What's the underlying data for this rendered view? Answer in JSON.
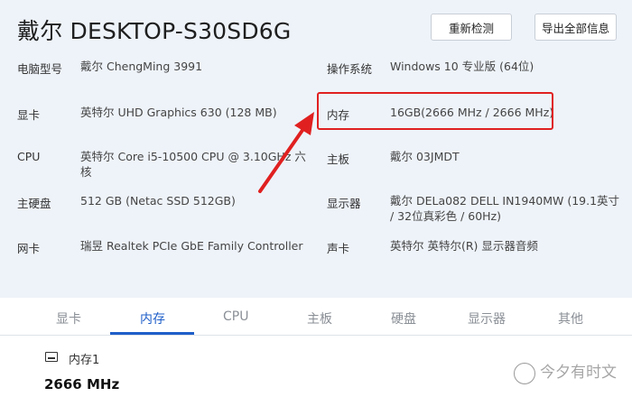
{
  "header": {
    "title": "戴尔 DESKTOP-S30SD6G",
    "redetect_label": "重新检测",
    "export_label": "导出全部信息"
  },
  "specs": {
    "model_label": "电脑型号",
    "model_value": "戴尔 ChengMing 3991",
    "os_label": "操作系统",
    "os_value": "Windows 10 专业版 (64位)",
    "gpu_label": "显卡",
    "gpu_value": "英特尔 UHD Graphics 630 (128 MB)",
    "memory_label": "内存",
    "memory_value": "16GB(2666 MHz / 2666 MHz)",
    "cpu_label": "CPU",
    "cpu_value_line1": "英特尔 Core i5-10500 CPU @ 3.10GHz 六",
    "cpu_value_line2": "核",
    "motherboard_label": "主板",
    "motherboard_value": "戴尔 03JMDT",
    "disk_label": "主硬盘",
    "disk_value": "512 GB (Netac SSD 512GB)",
    "monitor_label": "显示器",
    "monitor_value_line1": "戴尔 DELa082 DELL IN1940MW (19.1英寸",
    "monitor_value_line2": "/ 32位真彩色 / 60Hz)",
    "nic_label": "网卡",
    "nic_value": "瑞昱 Realtek PCIe GbE Family Controller",
    "sound_label": "声卡",
    "sound_value": "英特尔 英特尔(R) 显示器音频"
  },
  "tabs": [
    "显卡",
    "内存",
    "CPU",
    "主板",
    "硬盘",
    "显示器",
    "其他"
  ],
  "active_tab": "内存",
  "memory_detail": {
    "slot_label": "内存1",
    "speed": "2666 MHz"
  },
  "watermark": "今夕有时文",
  "colors": {
    "accent": "#1f5fc9",
    "highlight": "#e02020",
    "background": "#eef3f9"
  },
  "icons": [
    "memory-module-icon"
  ]
}
